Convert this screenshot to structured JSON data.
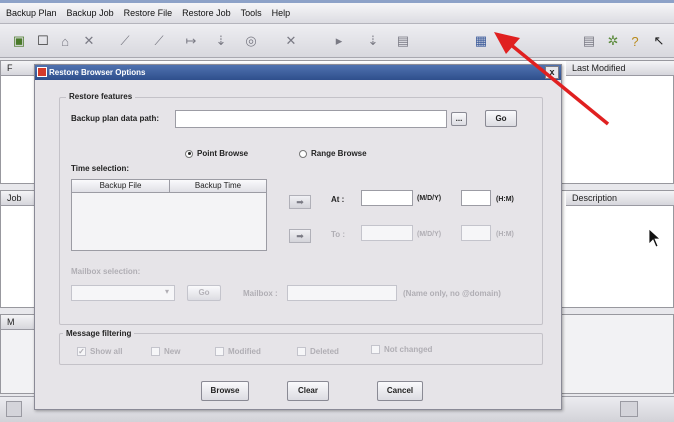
{
  "menu": [
    "Backup Plan",
    "Backup Job",
    "Restore File",
    "Restore Job",
    "Tools",
    "Help"
  ],
  "panes": {
    "top_left_initial": "F",
    "last_modified": "Last Modified",
    "job_initial": "Job",
    "description": "Description",
    "bottom_initial": "M"
  },
  "dialog": {
    "title": "Restore Browser Options",
    "close": "x",
    "restore_features": "Restore features",
    "backup_plan_path_label": "Backup plan data path:",
    "browse_small": "...",
    "go": "Go",
    "point_browse": "Point Browse",
    "range_browse": "Range Browse",
    "time_selection": "Time selection:",
    "col_backup_file": "Backup File",
    "col_backup_time": "Backup Time",
    "at_label": "At :",
    "to_label": "To :",
    "date_fmt": "(M/D/Y)",
    "time_fmt": "(H:M)",
    "mailbox_selection": "Mailbox selection:",
    "mailbox_go": "Go",
    "mailbox_label": "Mailbox :",
    "mailbox_hint": "(Name only, no @domain)",
    "message_filtering": "Message filtering",
    "filters": [
      "Show all",
      "New",
      "Modified",
      "Deleted",
      "Not changed"
    ],
    "buttons": {
      "browse": "Browse",
      "clear": "Clear",
      "cancel": "Cancel"
    }
  },
  "colors": {
    "title_bar": "#2f4f8c",
    "arrow": "#e02020"
  }
}
